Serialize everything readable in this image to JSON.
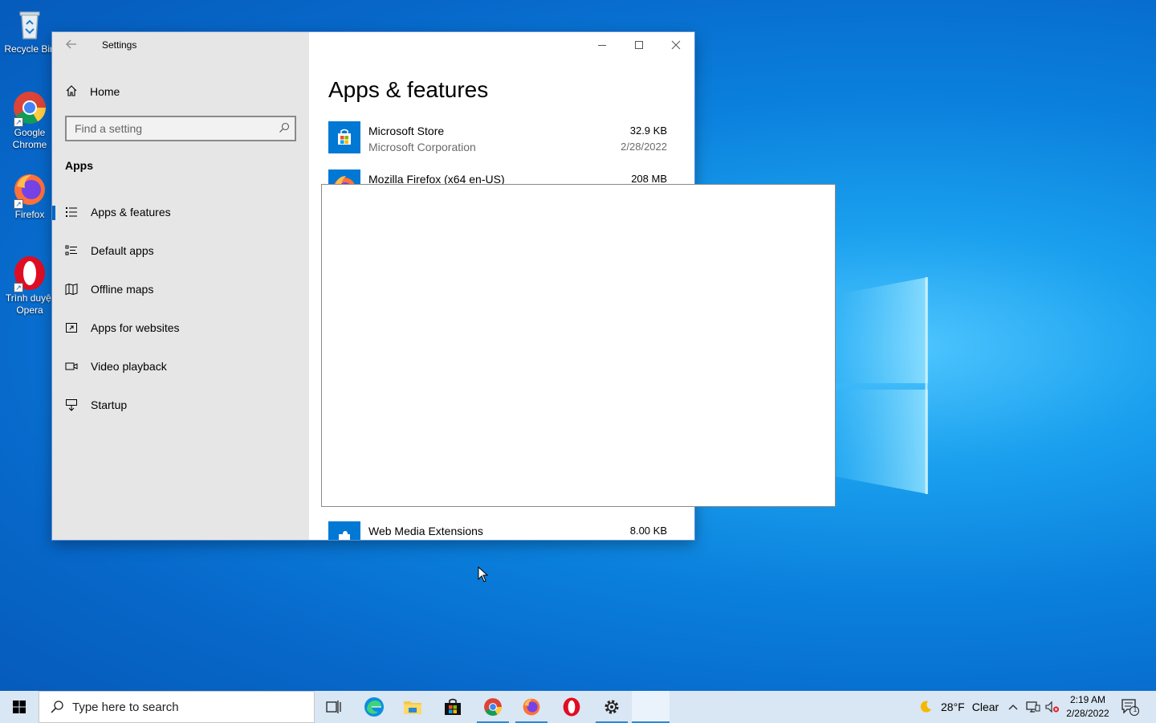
{
  "desktop": {
    "icons": [
      {
        "label": "Recycle Bin",
        "icon": "recycle-bin-icon"
      },
      {
        "label": "Google Chrome",
        "icon": "chrome-icon"
      },
      {
        "label": "Firefox",
        "icon": "firefox-icon"
      },
      {
        "label": "Trình duyệt Opera",
        "icon": "opera-icon"
      }
    ]
  },
  "window": {
    "title": "Settings",
    "back_icon": "back-arrow-icon",
    "controls": {
      "minimize": "minimize-icon",
      "maximize": "maximize-icon",
      "close": "close-icon"
    }
  },
  "sidebar": {
    "home_label": "Home",
    "search_placeholder": "Find a setting",
    "section_title": "Apps",
    "items": [
      {
        "label": "Apps & features",
        "icon": "apps-features-icon",
        "active": true
      },
      {
        "label": "Default apps",
        "icon": "default-apps-icon",
        "active": false
      },
      {
        "label": "Offline maps",
        "icon": "offline-maps-icon",
        "active": false
      },
      {
        "label": "Apps for websites",
        "icon": "apps-websites-icon",
        "active": false
      },
      {
        "label": "Video playback",
        "icon": "video-playback-icon",
        "active": false
      },
      {
        "label": "Startup",
        "icon": "startup-icon",
        "active": false
      }
    ]
  },
  "main": {
    "heading": "Apps & features",
    "apps": [
      {
        "name": "Microsoft Store",
        "publisher": "Microsoft Corporation",
        "size": "32.9 KB",
        "date": "2/28/2022",
        "icon": "microsoft-store-icon"
      },
      {
        "name": "Mozilla Firefox (x64 en-US)",
        "publisher": "",
        "size": "208 MB",
        "date": "",
        "icon": "firefox-icon"
      },
      {
        "name": "Web Media Extensions",
        "publisher": "",
        "size": "8.00 KB",
        "date": "",
        "icon": "web-media-extensions-icon"
      }
    ]
  },
  "taskbar": {
    "search_placeholder": "Type here to search",
    "weather_temp": "28°F",
    "weather_desc": "Clear",
    "time": "2:19 AM",
    "date": "2/28/2022",
    "notification_count": "1",
    "accent": "#2b88d8"
  }
}
